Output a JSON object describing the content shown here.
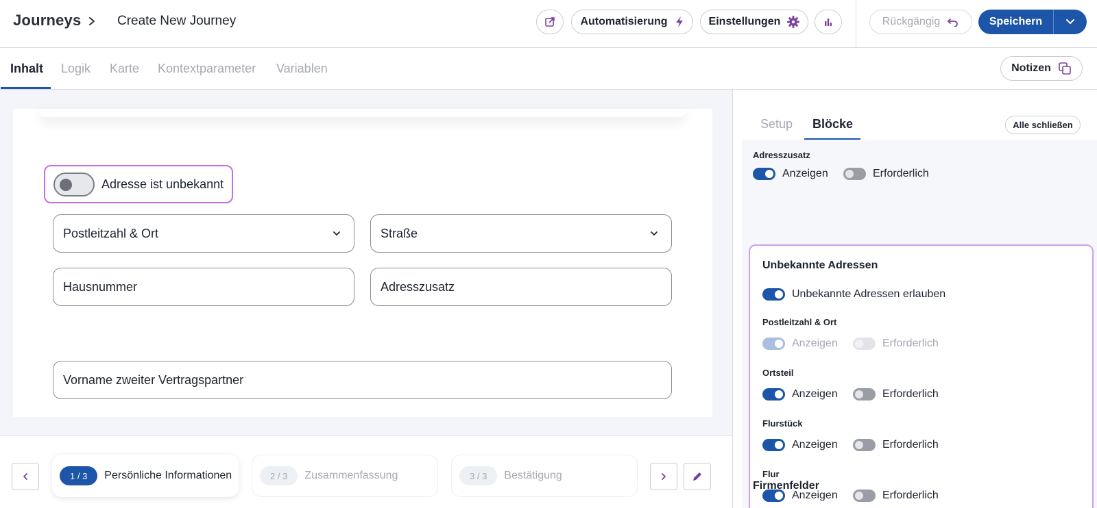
{
  "header": {
    "brand": "Journeys",
    "journey_title": "Create New Journey",
    "automation_label": "Automatisierung",
    "settings_label": "Einstellungen",
    "undo_label": "Rückgängig",
    "save_label": "Speichern"
  },
  "tabs": [
    {
      "label": "Inhalt",
      "active": true
    },
    {
      "label": "Logik",
      "active": false
    },
    {
      "label": "Karte",
      "active": false
    },
    {
      "label": "Kontextparameter",
      "active": false
    },
    {
      "label": "Variablen",
      "active": false
    }
  ],
  "notes_label": "Notizen",
  "form": {
    "unknown_address_label": "Adresse ist unbekannt",
    "unknown_address_on": false,
    "fields": {
      "zip_city": "Postleitzahl & Ort",
      "street": "Straße",
      "house_number": "Hausnummer",
      "address_addition": "Adresszusatz",
      "second_partner_first_name": "Vorname zweiter Vertragspartner"
    }
  },
  "stepper": {
    "steps": [
      {
        "index": "1 / 3",
        "label": "Persönliche Informationen",
        "active": true
      },
      {
        "index": "2 / 3",
        "label": "Zusammenfassung",
        "active": false
      },
      {
        "index": "3 / 3",
        "label": "Bestätigung",
        "active": false
      }
    ]
  },
  "right_panel": {
    "tabs": [
      {
        "label": "Setup",
        "active": false
      },
      {
        "label": "Blöcke",
        "active": true
      }
    ],
    "close_all_label": "Alle schließen",
    "show_label": "Anzeigen",
    "required_label": "Erforderlich",
    "address_addition": {
      "title": "Adresszusatz",
      "show": true,
      "required": false
    },
    "unknown_addresses": {
      "title": "Unbekannte Adressen",
      "allow_label": "Unbekannte Adressen erlauben",
      "allow": true,
      "blocks": [
        {
          "title": "Postleitzahl & Ort",
          "show": true,
          "required": false,
          "disabled": true
        },
        {
          "title": "Ortsteil",
          "show": true,
          "required": false,
          "disabled": false
        },
        {
          "title": "Flurstück",
          "show": true,
          "required": false,
          "disabled": false
        },
        {
          "title": "Flur",
          "show": true,
          "required": false,
          "disabled": false
        }
      ]
    },
    "company_fields_title": "Firmenfelder"
  },
  "colors": {
    "primary": "#1d55a8",
    "highlight": "#c66ee0",
    "accent_icon": "#7b3fa0"
  }
}
